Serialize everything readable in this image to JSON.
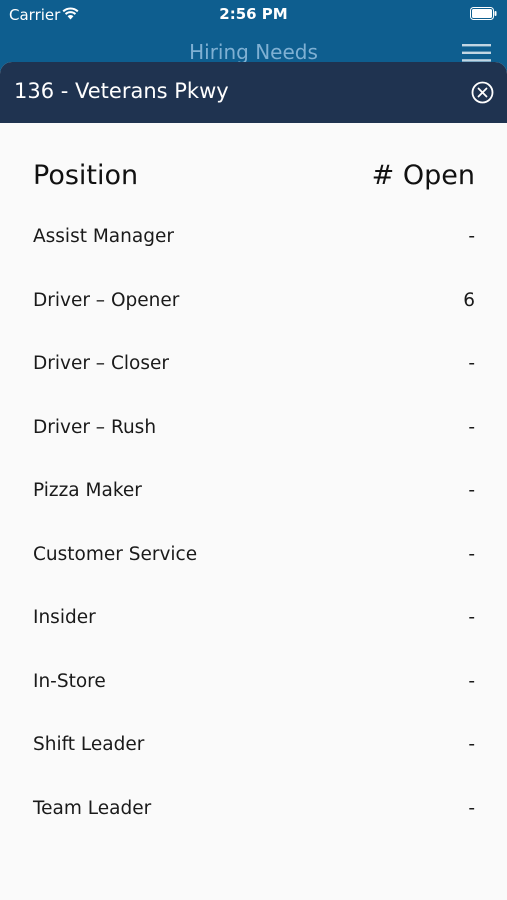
{
  "status_bar": {
    "carrier": "Carrier",
    "time": "2:56 PM"
  },
  "nav": {
    "title": "Hiring Needs"
  },
  "sheet": {
    "title": "136 - Veterans Pkwy",
    "table": {
      "headers": {
        "position": "Position",
        "open": "# Open"
      },
      "rows": [
        {
          "position": "Assist Manager",
          "open": "-"
        },
        {
          "position": "Driver – Opener",
          "open": "6"
        },
        {
          "position": "Driver – Closer",
          "open": "-"
        },
        {
          "position": "Driver – Rush",
          "open": "-"
        },
        {
          "position": "Pizza Maker",
          "open": "-"
        },
        {
          "position": "Customer Service",
          "open": "-"
        },
        {
          "position": "Insider",
          "open": "-"
        },
        {
          "position": "In-Store",
          "open": "-"
        },
        {
          "position": "Shift Leader",
          "open": "-"
        },
        {
          "position": "Team Leader",
          "open": "-"
        }
      ]
    }
  },
  "icons": {
    "wifi": "wifi-icon",
    "battery": "battery-icon",
    "menu": "hamburger-menu-icon",
    "close": "close-circle-icon"
  },
  "colors": {
    "app_bar": "#0e5e8f",
    "sheet_header": "#1f3350",
    "background": "#fafafa",
    "nav_title": "#7fb0d3"
  }
}
